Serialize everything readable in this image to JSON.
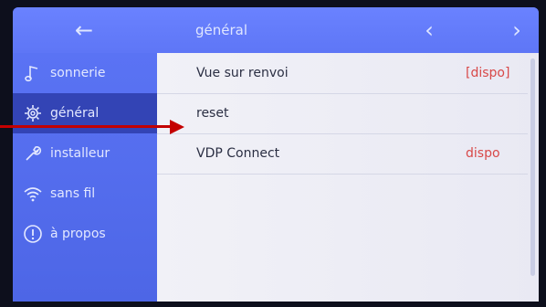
{
  "header": {
    "back_icon": "arrow-left-icon",
    "title": "général",
    "prev_icon": "chevron-left-icon",
    "next_icon": "chevron-right-icon"
  },
  "sidebar": {
    "items": [
      {
        "label": "sonnerie",
        "icon": "music-note-icon",
        "active": false
      },
      {
        "label": "général",
        "icon": "gear-icon",
        "active": true
      },
      {
        "label": "installeur",
        "icon": "wrench-icon",
        "active": false
      },
      {
        "label": "sans fil",
        "icon": "wifi-icon",
        "active": false
      },
      {
        "label": "à propos",
        "icon": "info-icon",
        "active": false
      }
    ]
  },
  "content": {
    "rows": [
      {
        "label": "Vue sur renvoi",
        "value": "[dispo]"
      },
      {
        "label": "reset",
        "value": ""
      },
      {
        "label": "VDP Connect",
        "value": "dispo"
      }
    ]
  },
  "colors": {
    "accent": "#5e76f6",
    "active_bg": "#3344b5",
    "status_red": "#d84848",
    "annotation_arrow": "#c40000"
  }
}
